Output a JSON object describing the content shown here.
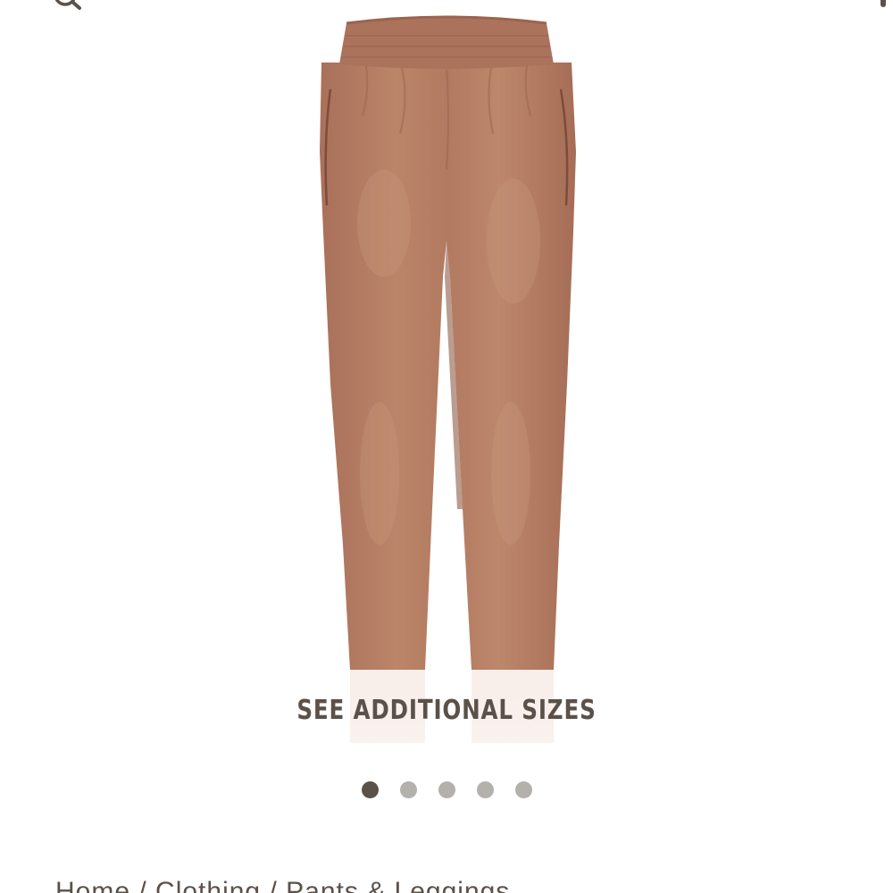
{
  "header": {
    "search_icon": "search-icon",
    "menu_icon": "menu-icon"
  },
  "product": {
    "image_alt": "tan velour jogger pants",
    "main_color": "#b57d64"
  },
  "gallery": {
    "see_sizes_label": "SEE ADDITIONAL SIZES",
    "slide_count": 5,
    "active_slide": 1,
    "dot_active_color": "#5b5149",
    "dot_inactive_color": "#b4b0ac"
  },
  "breadcrumb": {
    "items": [
      "Home",
      "Clothing",
      "Pants & Leggings"
    ],
    "separator": " / "
  }
}
